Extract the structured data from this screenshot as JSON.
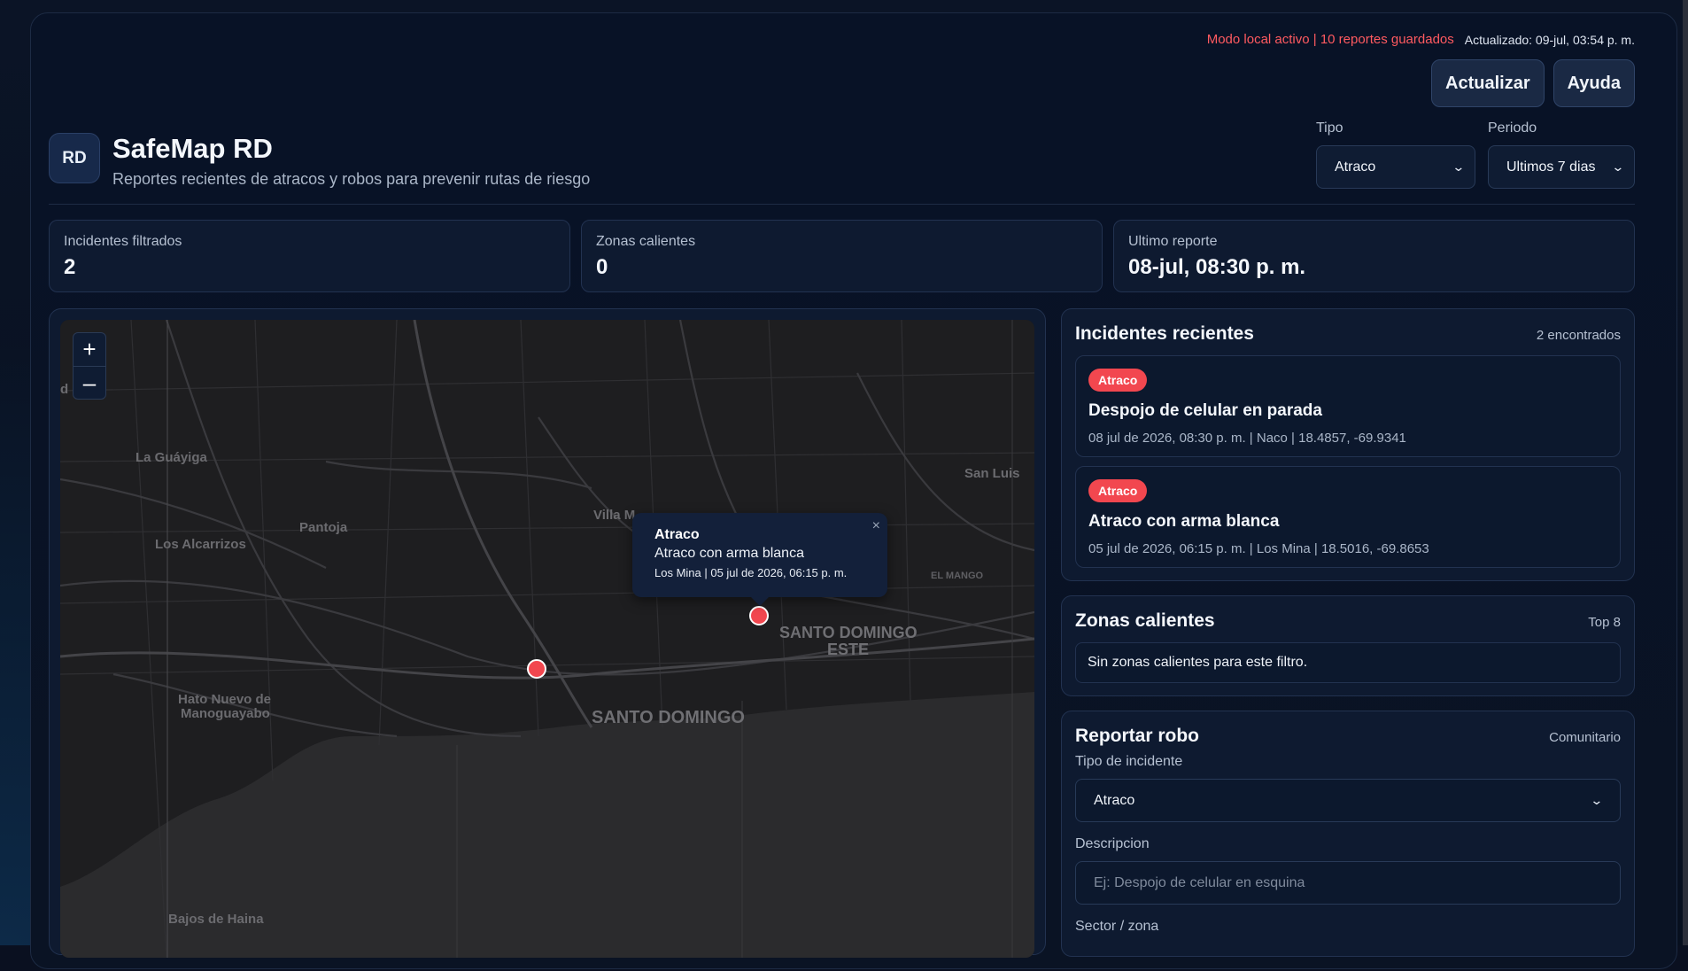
{
  "status": {
    "local_mode": "Modo local activo | 10 reportes guardados",
    "updated": "Actualizado: 09-jul, 03:54 p. m."
  },
  "buttons": {
    "refresh": "Actualizar",
    "help": "Ayuda"
  },
  "brand": {
    "logo": "RD",
    "title": "SafeMap RD",
    "subtitle": "Reportes recientes de atracos y robos para prevenir rutas de riesgo"
  },
  "filters": {
    "type_label": "Tipo",
    "type_value": "Atraco",
    "period_label": "Periodo",
    "period_value": "Ultimos 7 dias"
  },
  "stats": [
    {
      "label": "Incidentes filtrados",
      "value": "2"
    },
    {
      "label": "Zonas calientes",
      "value": "0"
    },
    {
      "label": "Ultimo reporte",
      "value": "08-jul, 08:30 p. m."
    }
  ],
  "map": {
    "zoom_in": "+",
    "zoom_out": "–",
    "labels": {
      "la_guayiga": "La Guáyiga",
      "san_luis": "San Luis",
      "pantoja": "Pantoja",
      "villa_mella": "Villa M",
      "los_alcarrizos": "Los Alcarrizos",
      "el_manguito": "EL MANGO",
      "sde_1": "SANTO DOMINGO",
      "sde_2": "ESTE",
      "hato_1": "Hato Nuevo de",
      "hato_2": "Manoguayabo",
      "santo_domingo": "SANTO DOMINGO",
      "bajos_haina": "Bajos de Haina",
      "d": "d"
    },
    "popup": {
      "type": "Atraco",
      "description": "Atraco con arma blanca",
      "meta": "Los Mina | 05 jul de 2026, 06:15 p. m.",
      "close": "×"
    }
  },
  "recent": {
    "title": "Incidentes recientes",
    "count": "2 encontrados",
    "items": [
      {
        "badge": "Atraco",
        "title": "Despojo de celular en parada",
        "meta": "08 jul de 2026, 08:30 p. m. | Naco | 18.4857, -69.9341"
      },
      {
        "badge": "Atraco",
        "title": "Atraco con arma blanca",
        "meta": "05 jul de 2026, 06:15 p. m. | Los Mina | 18.5016, -69.8653"
      }
    ]
  },
  "hot_zones": {
    "title": "Zonas calientes",
    "tag": "Top 8",
    "empty": "Sin zonas calientes para este filtro."
  },
  "report": {
    "title": "Reportar robo",
    "tag": "Comunitario",
    "type_label": "Tipo de incidente",
    "type_value": "Atraco",
    "desc_label": "Descripcion",
    "desc_placeholder": "Ej: Despojo de celular en esquina",
    "sector_label": "Sector / zona"
  },
  "colors": {
    "accent_red": "#f2474f",
    "status_red": "#ff5a60",
    "panel": "#0e1a30"
  }
}
